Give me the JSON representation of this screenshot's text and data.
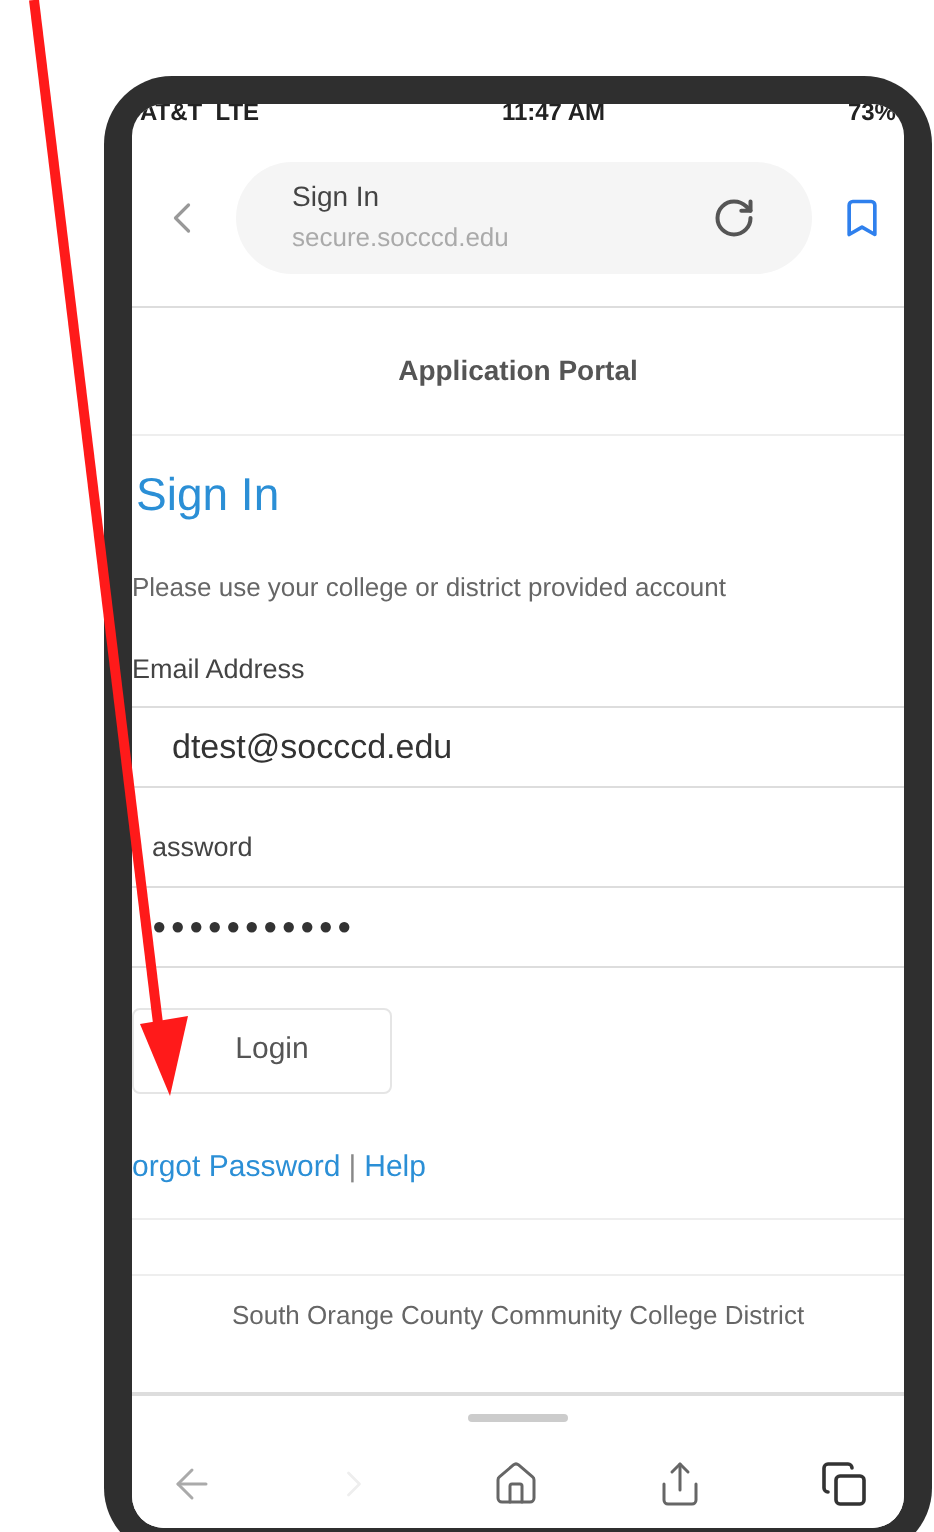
{
  "status_bar": {
    "carrier": "AT&T  LTE",
    "time": "11:47 AM",
    "battery": "73%"
  },
  "address_bar": {
    "title": "Sign In",
    "url": "secure.socccd.edu"
  },
  "page": {
    "header": "Application Portal",
    "heading": "Sign In",
    "instructions": "Please use your college or district provided account",
    "fields": [
      {
        "label": "Email Address",
        "value": "dtest@socccd.edu",
        "kind": "text"
      },
      {
        "label": "assword",
        "value": "●●●●●●●●●●●",
        "kind": "password"
      }
    ],
    "login_button": "Login",
    "links": [
      "orgot Password",
      "Help"
    ],
    "link_separator": "|",
    "footer": "South Orange County Community College District"
  }
}
